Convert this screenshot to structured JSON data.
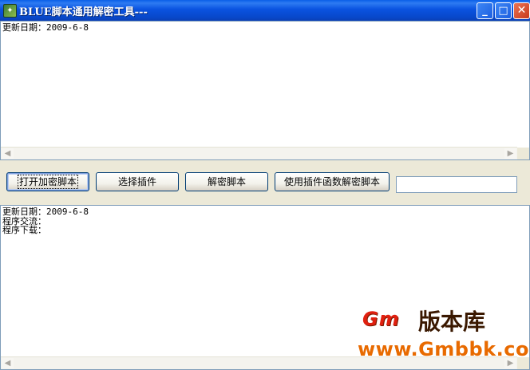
{
  "window": {
    "title": "BLUE脚本通用解密工具---",
    "icon": "app-icon"
  },
  "top_edit": {
    "lines": [
      "更新日期：2009-6-8"
    ]
  },
  "toolbar": {
    "open_label": "打开加密脚本",
    "plugin_label": "选择插件",
    "decrypt_label": "解密脚本",
    "plugin_decrypt_label": "使用插件函数解密脚本",
    "text_value": ""
  },
  "bottom_edit": {
    "lines": [
      "更新日期：2009-6-8",
      "程序交流：",
      "程序下载："
    ]
  },
  "watermark": {
    "logo": "Gm",
    "name": "版本库",
    "url": "www.Gmbbk.com"
  }
}
